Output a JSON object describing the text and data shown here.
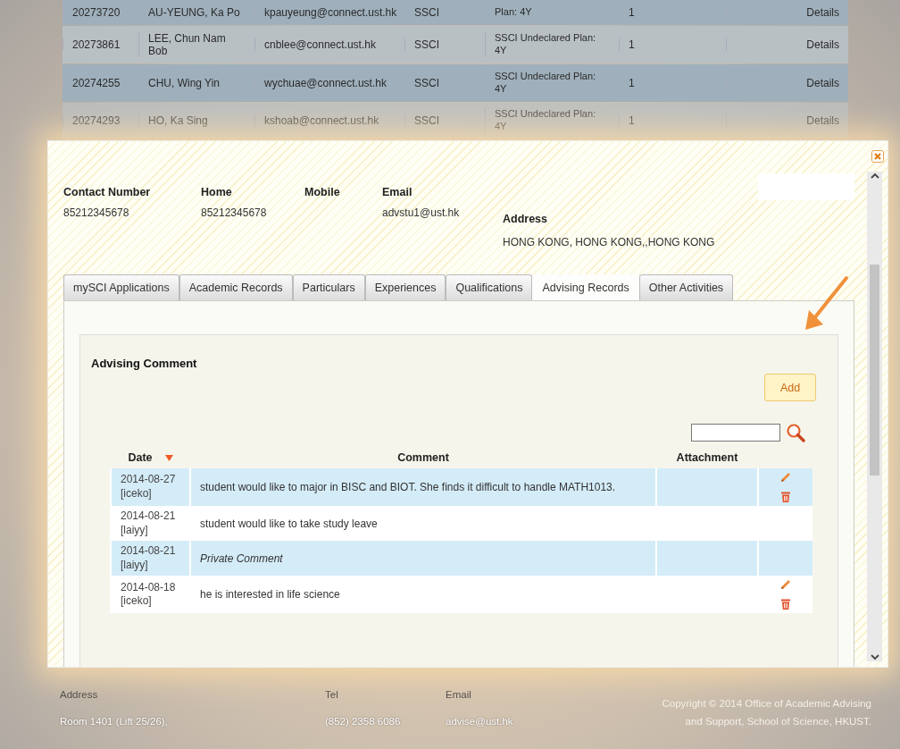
{
  "background_table": {
    "rows": [
      {
        "cells": [
          "20273720",
          "AU-YEUNG, Ka Po",
          "kpauyeung@connect.ust.hk",
          "SSCI",
          "Plan: 4Y",
          "1",
          "Details"
        ],
        "faded": false
      },
      {
        "cells": [
          "20273861",
          "LEE, Chun Nam Bob",
          "cnblee@connect.ust.hk",
          "SSCI",
          "SSCI Undeclared Plan: 4Y",
          "1",
          "Details"
        ],
        "faded": false
      },
      {
        "cells": [
          "20274255",
          "CHU, Wing Yin",
          "wychuae@connect.ust.hk",
          "SSCI",
          "SSCI Undeclared Plan: 4Y",
          "1",
          "Details"
        ],
        "faded": false
      },
      {
        "cells": [
          "20274293",
          "HO, Ka Sing",
          "kshoab@connect.ust.hk",
          "SSCI",
          "SSCI Undeclared Plan: 4Y",
          "1",
          "Details"
        ],
        "faded": true
      }
    ]
  },
  "modal": {
    "contacts": [
      {
        "label": "Contact Number",
        "value": "85212345678"
      },
      {
        "label": "Home",
        "value": "85212345678"
      },
      {
        "label": "Mobile"
      },
      {
        "label": "Email",
        "value": "advstu1@ust.hk"
      }
    ],
    "address": {
      "label": "Address",
      "value": "HONG KONG, HONG KONG,,HONG KONG"
    },
    "tabs": [
      {
        "label": "mySCI Applications",
        "selected": false
      },
      {
        "label": "Academic Records",
        "selected": false
      },
      {
        "label": "Particulars",
        "selected": false
      },
      {
        "label": "Experiences",
        "selected": false
      },
      {
        "label": "Qualifications",
        "selected": false
      },
      {
        "label": "Advising Records",
        "selected": true
      },
      {
        "label": "Other Activities",
        "selected": false
      }
    ],
    "section_title": "Advising Comment",
    "add_button": "Add",
    "table": {
      "columns": [
        "Date",
        "Comment",
        "Attachment"
      ],
      "rows": [
        {
          "date": "2014-08-27 [iceko]",
          "comment": "student would like to major in BISC and BIOT. She finds it difficult to handle MATH1013.",
          "private": false,
          "editable": true
        },
        {
          "date": "2014-08-21 [laiyy]",
          "comment": "student would like to take study leave",
          "private": false,
          "editable": false
        },
        {
          "date": "2014-08-21 [laiyy]",
          "comment": "Private Comment",
          "private": true,
          "editable": false
        },
        {
          "date": "2014-08-18 [iceko]",
          "comment": "he is interested in life science",
          "private": false,
          "editable": true
        }
      ]
    }
  },
  "footer": {
    "columns": [
      {
        "label": "Address",
        "value": "Room 1401 (Lift 25/26),"
      },
      {
        "label": "Tel",
        "value": "(852) 2358 6086"
      },
      {
        "label": "Email",
        "value": "advise@ust.hk"
      }
    ],
    "copyright": [
      "Copyright © 2014 Office of Academic Advising",
      "and Support, School of Science, HKUST."
    ]
  }
}
